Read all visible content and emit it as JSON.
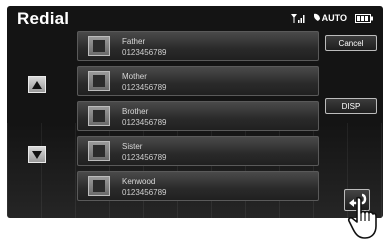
{
  "header": {
    "title": "Redial",
    "status": {
      "auto_label": "AUTO"
    }
  },
  "list": {
    "items": [
      {
        "name": "Father",
        "number": "0123456789"
      },
      {
        "name": "Mother",
        "number": "0123456789"
      },
      {
        "name": "Brother",
        "number": "0123456789"
      },
      {
        "name": "Sister",
        "number": "0123456789"
      },
      {
        "name": "Kenwood",
        "number": "0123456789"
      }
    ]
  },
  "buttons": {
    "cancel": "Cancel",
    "disp": "DISP"
  },
  "icons": {
    "signal": "signal-strength-icon",
    "auto": "auto-answer-icon",
    "battery": "battery-icon",
    "scroll_up": "triangle-up-icon",
    "scroll_down": "triangle-down-icon",
    "return": "return-icon",
    "hand": "pointing-hand-icon"
  }
}
